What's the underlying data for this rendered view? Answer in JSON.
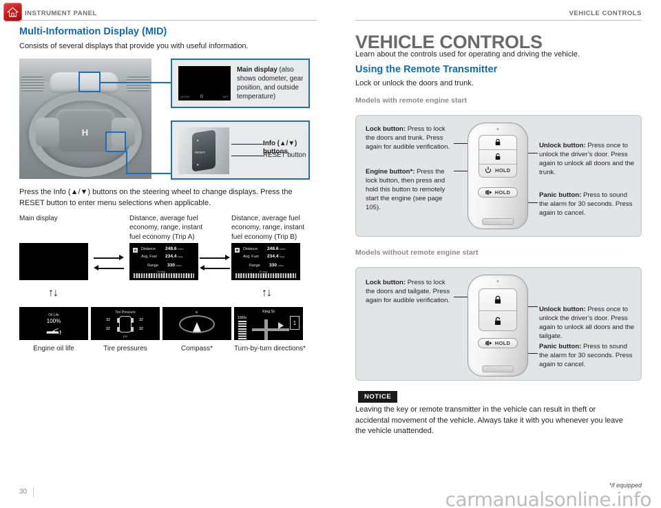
{
  "header": {
    "home_icon": "home-icon",
    "running_head_left": "INSTRUMENT PANEL",
    "running_head_right": "VEHICLE CONTROLS"
  },
  "left": {
    "section_title": "Multi-Information Display (MID)",
    "intro": "Consists of several displays that provide you with useful information.",
    "callouts": [
      {
        "label_bold": "Main display",
        "label_rest": " (also shows odometer, gear position, and outside temperature)",
        "screen": {
          "odometer": "002345",
          "odometer_unit": "miles",
          "gear": "D",
          "temp": "63°F"
        }
      },
      {
        "info_buttons": "Info (▲/▼) buttons",
        "reset_button": "RESET button"
      }
    ],
    "instruction": "Press the Info (▲/▼) buttons on the steering wheel to change displays. Press the RESET button to enter menu selections when applicable.",
    "flow_top_captions": [
      "Main display",
      "Distance, average fuel economy, range, instant fuel economy (Trip A)",
      "Distance, average fuel economy, range, instant fuel economy (Trip B)"
    ],
    "trip_a": {
      "badge": "A",
      "distance_label": "Distance",
      "distance_value": "248.6",
      "distance_unit": "miles",
      "avgfuel_label": "Avg. Fuel",
      "avgfuel_value": "234.4",
      "avgfuel_unit": "mpg",
      "range_label": "Range",
      "range_value": "330",
      "range_unit": "miles",
      "bar_label": "25 mpg"
    },
    "trip_b": {
      "badge": "B",
      "distance_label": "Distance",
      "distance_value": "248.6",
      "distance_unit": "miles",
      "avgfuel_label": "Avg. Fuel",
      "avgfuel_value": "234.4",
      "avgfuel_unit": "mpg",
      "range_label": "Range",
      "range_value": "330",
      "range_unit": "miles",
      "bar_label": "40 mpg"
    },
    "bottom_captions": [
      "Engine oil life",
      "Tire pressures",
      "Compass*",
      "Turn-by-turn directions*"
    ],
    "oil": {
      "title": "Oil Life",
      "value": "100%"
    },
    "tpms": {
      "title": "Tire Pressure",
      "fl": "32",
      "fr": "32",
      "rl": "32",
      "rr": "32",
      "unit": "psi"
    },
    "compass": {
      "north": "N"
    },
    "turn": {
      "street": "King St",
      "distance": "1000",
      "distance_unit": "ft",
      "sign": "1"
    }
  },
  "right": {
    "chapter_title": "VEHICLE CONTROLS",
    "chapter_intro": "Learn about the controls used for operating and driving the vehicle.",
    "section_title": "Using the Remote Transmitter",
    "section_intro": "Lock or unlock the doors and trunk.",
    "group_1_label": "Models with remote engine start",
    "group_1": {
      "lock": {
        "bold": "Lock button:",
        "text": " Press to lock the doors and trunk. Press again for audible verification."
      },
      "engine": {
        "bold": "Engine button*:",
        "text": " Press the lock button, then press and hold this button to remotely start the engine (see page 105)."
      },
      "unlock": {
        "bold": "Unlock button:",
        "text": " Press once to unlock the driver’s door. Press again to unlock all doors and the trunk."
      },
      "panic": {
        "bold": "Panic button:",
        "text": " Press to sound the alarm for 30 seconds. Press again to cancel."
      },
      "fob": {
        "engine_hold": "HOLD",
        "panic_hold": "HOLD"
      }
    },
    "group_2_label": "Models without remote engine start",
    "group_2": {
      "lock": {
        "bold": "Lock button:",
        "text": " Press to lock the doors and tailgate. Press again for audible verification."
      },
      "unlock": {
        "bold": "Unlock button:",
        "text": " Press once to unlock the driver’s door. Press again to unlock all doors and the tailgate."
      },
      "panic": {
        "bold": "Panic button:",
        "text": " Press to sound the alarm for 30 seconds. Press again to cancel."
      },
      "fob": {
        "panic_hold": "HOLD"
      }
    },
    "notice_tag": "NOTICE",
    "notice_text": "Leaving the key or remote transmitter in the vehicle can result in theft or accidental movement of the vehicle. Always take it with you whenever you leave the vehicle unattended."
  },
  "footer": {
    "page_number": "30",
    "if_equipped": "*if equipped",
    "watermark": "carmanualsonline.info"
  },
  "colors": {
    "accent_blue": "#0f6bb5",
    "callout_border": "#1b6fb8",
    "panel_bg": "#e3e4e5",
    "runhead_gray": "#6e6e6e",
    "home_red": "#cf1d1d"
  }
}
